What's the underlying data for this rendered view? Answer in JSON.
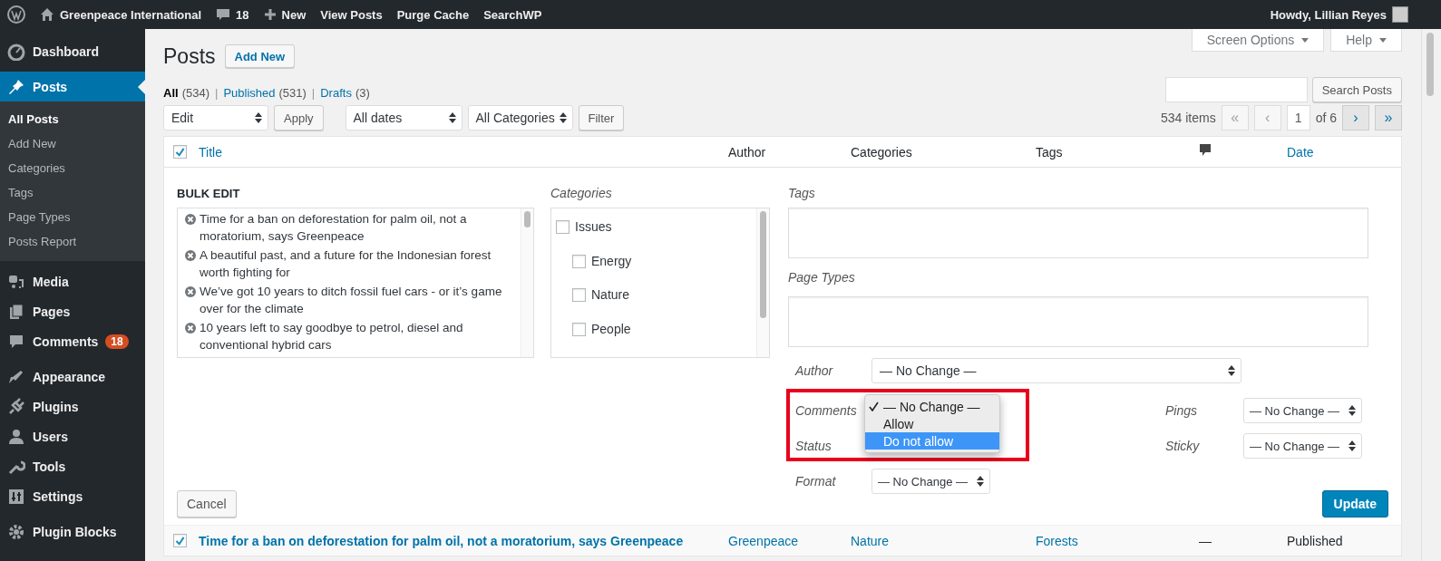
{
  "admin_bar": {
    "site": "Greenpeace International",
    "comments_count": "18",
    "new": "New",
    "links": [
      "View Posts",
      "Purge Cache",
      "SearchWP"
    ],
    "account": "Howdy, Lillian Reyes"
  },
  "sidebar": {
    "items": [
      {
        "label": "Dashboard",
        "selected": false
      },
      {
        "label": "Posts",
        "selected": true,
        "children": [
          {
            "label": "All Posts",
            "selected": true
          },
          {
            "label": "Add New",
            "selected": false
          },
          {
            "label": "Categories",
            "selected": false
          },
          {
            "label": "Tags",
            "selected": false
          },
          {
            "label": "Page Types",
            "selected": false
          },
          {
            "label": "Posts Report",
            "selected": false
          }
        ]
      },
      {
        "label": "Media",
        "selected": false
      },
      {
        "label": "Pages",
        "selected": false
      },
      {
        "label": "Comments",
        "selected": false,
        "badge": "18"
      },
      {
        "label": "Appearance",
        "selected": false
      },
      {
        "label": "Plugins",
        "selected": false
      },
      {
        "label": "Users",
        "selected": false
      },
      {
        "label": "Tools",
        "selected": false
      },
      {
        "label": "Settings",
        "selected": false
      },
      {
        "label": "Plugin Blocks",
        "selected": false
      }
    ]
  },
  "screen_meta": [
    "Screen Options",
    "Help"
  ],
  "page": {
    "title": "Posts",
    "add_new": "Add New"
  },
  "views": [
    {
      "label": "All",
      "count": "(534)",
      "selected": true
    },
    {
      "separator": "|",
      "label": "Published",
      "count": "(531)",
      "selected": false
    },
    {
      "separator": "|",
      "label": "Drafts",
      "count": "(3)",
      "selected": false
    }
  ],
  "search": {
    "button": "Search Posts"
  },
  "tablenav": {
    "bulk_action": "Edit",
    "apply": "Apply",
    "date_filter": "All dates",
    "category_filter": "All Categories",
    "filter": "Filter",
    "items": "534 items",
    "page": "1",
    "of": "of 6",
    "pagination": [
      {
        "label": "«",
        "disabled": true
      },
      {
        "label": "‹",
        "disabled": true
      },
      {
        "label": "›",
        "disabled": false
      },
      {
        "label": "»",
        "disabled": false
      }
    ]
  },
  "table": {
    "select_all_checked": true,
    "columns": [
      {
        "label": "Title",
        "kind": "sortable"
      },
      {
        "label": "Author",
        "kind": "plain"
      },
      {
        "label": "Categories",
        "kind": "plain"
      },
      {
        "label": "Tags",
        "kind": "plain"
      },
      {
        "kind": "comments"
      },
      {
        "label": "Date",
        "kind": "sortable"
      }
    ]
  },
  "bulk_edit": {
    "title": "BULK EDIT",
    "posts": [
      "Time for a ban on deforestation for palm oil, not a moratorium, says Greenpeace",
      "A beautiful past, and a future for the Indonesian forest worth fighting for",
      "We’ve got 10 years to ditch fossil fuel cars - or it’s game over for the climate",
      "10 years left to say goodbye to petrol, diesel and conventional hybrid cars"
    ],
    "categories_label": "Categories",
    "categories": [
      {
        "label": "Issues",
        "checked": false,
        "children": [
          {
            "label": "Energy",
            "checked": false
          },
          {
            "label": "Nature",
            "checked": false
          },
          {
            "label": "People",
            "checked": false
          }
        ]
      }
    ],
    "tags_label": "Tags",
    "page_types_label": "Page Types",
    "author": {
      "label": "Author",
      "value": "— No Change —"
    },
    "comments": {
      "label": "Comments",
      "options": [
        {
          "label": "— No Change —",
          "checked": true,
          "highlighted": false
        },
        {
          "label": "Allow",
          "checked": false,
          "highlighted": false
        },
        {
          "label": "Do not allow",
          "checked": false,
          "highlighted": true
        }
      ]
    },
    "status": {
      "label": "Status"
    },
    "format": {
      "label": "Format",
      "value": "— No Change —"
    },
    "pings": {
      "label": "Pings",
      "value": "— No Change —"
    },
    "sticky": {
      "label": "Sticky",
      "value": "— No Change —"
    },
    "cancel": "Cancel",
    "update": "Update"
  },
  "rows": [
    {
      "checked": true,
      "title": "Time for a ban on deforestation for palm oil, not a moratorium, says Greenpeace",
      "author": "Greenpeace",
      "categories": "Nature",
      "tags": "Forests",
      "comments": "—",
      "date": "Published"
    }
  ]
}
